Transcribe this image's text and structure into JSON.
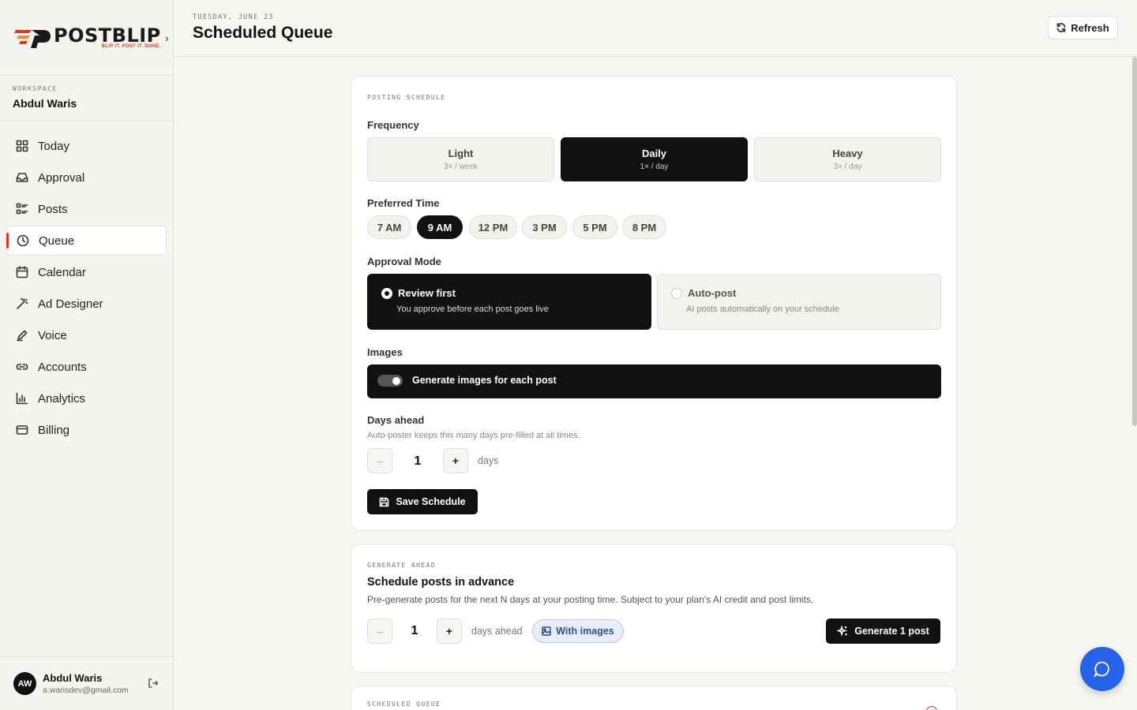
{
  "brand": {
    "name": "POSTBLIP",
    "tagline": "BLIP IT. POST IT. DONE.",
    "accent_color": "#d9381e"
  },
  "workspace": {
    "label": "WORKSPACE",
    "name": "Abdul Waris"
  },
  "sidebar": {
    "items": [
      {
        "label": "Today",
        "icon": "grid-icon"
      },
      {
        "label": "Approval",
        "icon": "inbox-icon"
      },
      {
        "label": "Posts",
        "icon": "list-icon"
      },
      {
        "label": "Queue",
        "icon": "clock-icon",
        "active": true
      },
      {
        "label": "Calendar",
        "icon": "calendar-icon"
      },
      {
        "label": "Ad Designer",
        "icon": "wand-icon"
      },
      {
        "label": "Voice",
        "icon": "pen-icon"
      },
      {
        "label": "Accounts",
        "icon": "link-icon"
      },
      {
        "label": "Analytics",
        "icon": "bar-chart-icon"
      },
      {
        "label": "Billing",
        "icon": "credit-card-icon"
      }
    ]
  },
  "user": {
    "initials": "AW",
    "name": "Abdul Waris",
    "email": "a.warisdev@gmail.com"
  },
  "header": {
    "date": "TUESDAY, JUNE 23",
    "title": "Scheduled Queue",
    "refresh_label": "Refresh"
  },
  "schedule": {
    "eyebrow": "POSTING SCHEDULE",
    "frequency_label": "Frequency",
    "frequencies": [
      {
        "label": "Light",
        "sub": "3× / week"
      },
      {
        "label": "Daily",
        "sub": "1× / day",
        "selected": true
      },
      {
        "label": "Heavy",
        "sub": "3× / day"
      }
    ],
    "time_label": "Preferred Time",
    "times": [
      "7 AM",
      "9 AM",
      "12 PM",
      "3 PM",
      "5 PM",
      "8 PM"
    ],
    "selected_time": "9 AM",
    "approval_label": "Approval Mode",
    "modes": [
      {
        "label": "Review first",
        "sub": "You approve before each post goes live",
        "selected": true
      },
      {
        "label": "Auto-post",
        "sub": "AI posts automatically on your schedule"
      }
    ],
    "images_label": "Images",
    "images_toggle_label": "Generate images for each post",
    "images_enabled": true,
    "days_label": "Days ahead",
    "days_help": "Auto-poster keeps this many days pre-filled at all times.",
    "days_value": "1",
    "days_unit": "days",
    "minus": "–",
    "plus": "+",
    "save_label": "Save Schedule"
  },
  "generate": {
    "eyebrow": "GENERATE AHEAD",
    "title": "Schedule posts in advance",
    "description": "Pre-generate posts for the next N days at your posting time. Subject to your plan's AI credit and post limits.",
    "minus": "–",
    "plus": "+",
    "days_value": "1",
    "days_unit": "days ahead",
    "with_images_label": "With images",
    "generate_label": "Generate 1 post"
  },
  "queue": {
    "eyebrow": "SCHEDULED QUEUE"
  },
  "colors": {
    "chat_button": "#2563eb",
    "primary": "#111111"
  }
}
